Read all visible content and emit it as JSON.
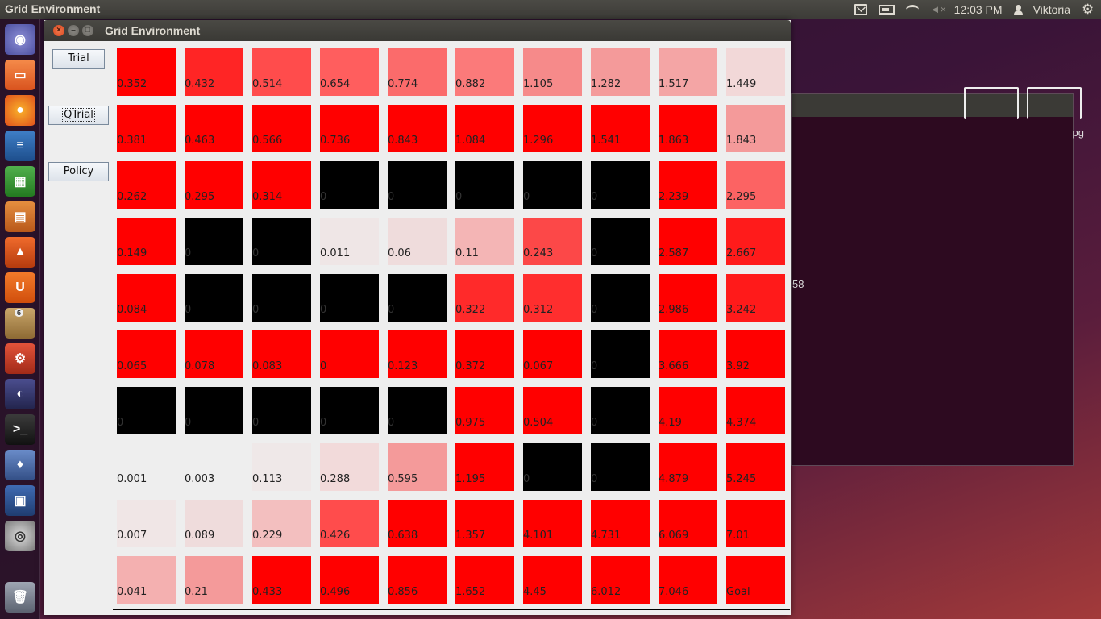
{
  "topbar": {
    "app_title": "Grid Environment",
    "clock": "12:03 PM",
    "user": "Viktoria"
  },
  "window": {
    "title": "Grid Environment"
  },
  "buttons": {
    "trial": "Trial",
    "qtrial": "QTrial",
    "policy": "Policy"
  },
  "launcher": {
    "badge": "6"
  },
  "background_window": {
    "text_right": "pg",
    "text_left": "58"
  },
  "grid": [
    [
      "0.352",
      "0.432",
      "0.514",
      "0.654",
      "0.774",
      "0.882",
      "1.105",
      "1.282",
      "1.517",
      "1.449"
    ],
    [
      "0.381",
      "0.463",
      "0.566",
      "0.736",
      "0.843",
      "1.084",
      "1.296",
      "1.541",
      "1.863",
      "1.843"
    ],
    [
      "0.262",
      "0.295",
      "0.314",
      "0",
      "0",
      "0",
      "0",
      "0",
      "2.239",
      "2.295"
    ],
    [
      "0.149",
      "0",
      "0",
      "0.011",
      "0.06",
      "0.11",
      "0.243",
      "0",
      "2.587",
      "2.667"
    ],
    [
      "0.084",
      "0",
      "0",
      "0",
      "0",
      "0.322",
      "0.312",
      "0",
      "2.986",
      "3.242"
    ],
    [
      "0.065",
      "0.078",
      "0.083",
      "0",
      "0.123",
      "0.372",
      "0.067",
      "0",
      "3.666",
      "3.92"
    ],
    [
      "0",
      "0",
      "0",
      "0",
      "0",
      "0.975",
      "0.504",
      "0",
      "4.19",
      "4.374"
    ],
    [
      "0.001",
      "0.003",
      "0.113",
      "0.288",
      "0.595",
      "1.195",
      "0",
      "0",
      "4.879",
      "5.245"
    ],
    [
      "0.007",
      "0.089",
      "0.229",
      "0.426",
      "0.638",
      "1.357",
      "4.101",
      "4.731",
      "6.069",
      "7.01"
    ],
    [
      "0.041",
      "0.21",
      "0.433",
      "0.496",
      "0.856",
      "1.652",
      "4.45",
      "6.012",
      "7.046",
      "Goal"
    ]
  ],
  "grid_colors": [
    [
      "#ff0000",
      "#ff2525",
      "#ff4c4c",
      "#ff5e5e",
      "#fb6b6b",
      "#fb7a7a",
      "#f68a8a",
      "#f49a9a",
      "#f4a5a5",
      "#f2d8d8"
    ],
    [
      "#ff0000",
      "#ff0000",
      "#ff0000",
      "#ff0000",
      "#ff0000",
      "#ff0000",
      "#ff0000",
      "#ff0000",
      "#ff0000",
      "#f49a9a"
    ],
    [
      "#ff0000",
      "#ff0000",
      "#ff0000",
      "#000000",
      "#000000",
      "#000000",
      "#000000",
      "#000000",
      "#ff0000",
      "#fc6363"
    ],
    [
      "#ff0000",
      "#000000",
      "#000000",
      "#efe6e6",
      "#efdcdc",
      "#f4b5b5",
      "#fc4848",
      "#000000",
      "#ff0000",
      "#ff1b1b"
    ],
    [
      "#ff0000",
      "#000000",
      "#000000",
      "#000000",
      "#000000",
      "#ff2a2a",
      "#ff2e2e",
      "#000000",
      "#ff0000",
      "#ff1a1a"
    ],
    [
      "#ff0000",
      "#ff0000",
      "#ff0000",
      "#ff0000",
      "#ff0000",
      "#ff0000",
      "#ff0000",
      "#000000",
      "#ff0000",
      "#ff0000"
    ],
    [
      "#000000",
      "#000000",
      "#000000",
      "#000000",
      "#000000",
      "#ff0000",
      "#ff0000",
      "#000000",
      "#ff0000",
      "#ff0000"
    ],
    [
      "#eeeeee",
      "#eeeeee",
      "#efe8e8",
      "#f2dada",
      "#f49a9a",
      "#ff0000",
      "#000000",
      "#000000",
      "#ff0000",
      "#ff0000"
    ],
    [
      "#f0e6e6",
      "#efdcdc",
      "#f3bfbf",
      "#ff4c4c",
      "#ff0000",
      "#ff0000",
      "#ff0000",
      "#ff0000",
      "#ff0000",
      "#ff0000"
    ],
    [
      "#f4b0b0",
      "#f49a9a",
      "#ff0000",
      "#ff0000",
      "#ff0000",
      "#ff0000",
      "#ff0000",
      "#ff0000",
      "#ff0000",
      "#ff0000"
    ]
  ]
}
